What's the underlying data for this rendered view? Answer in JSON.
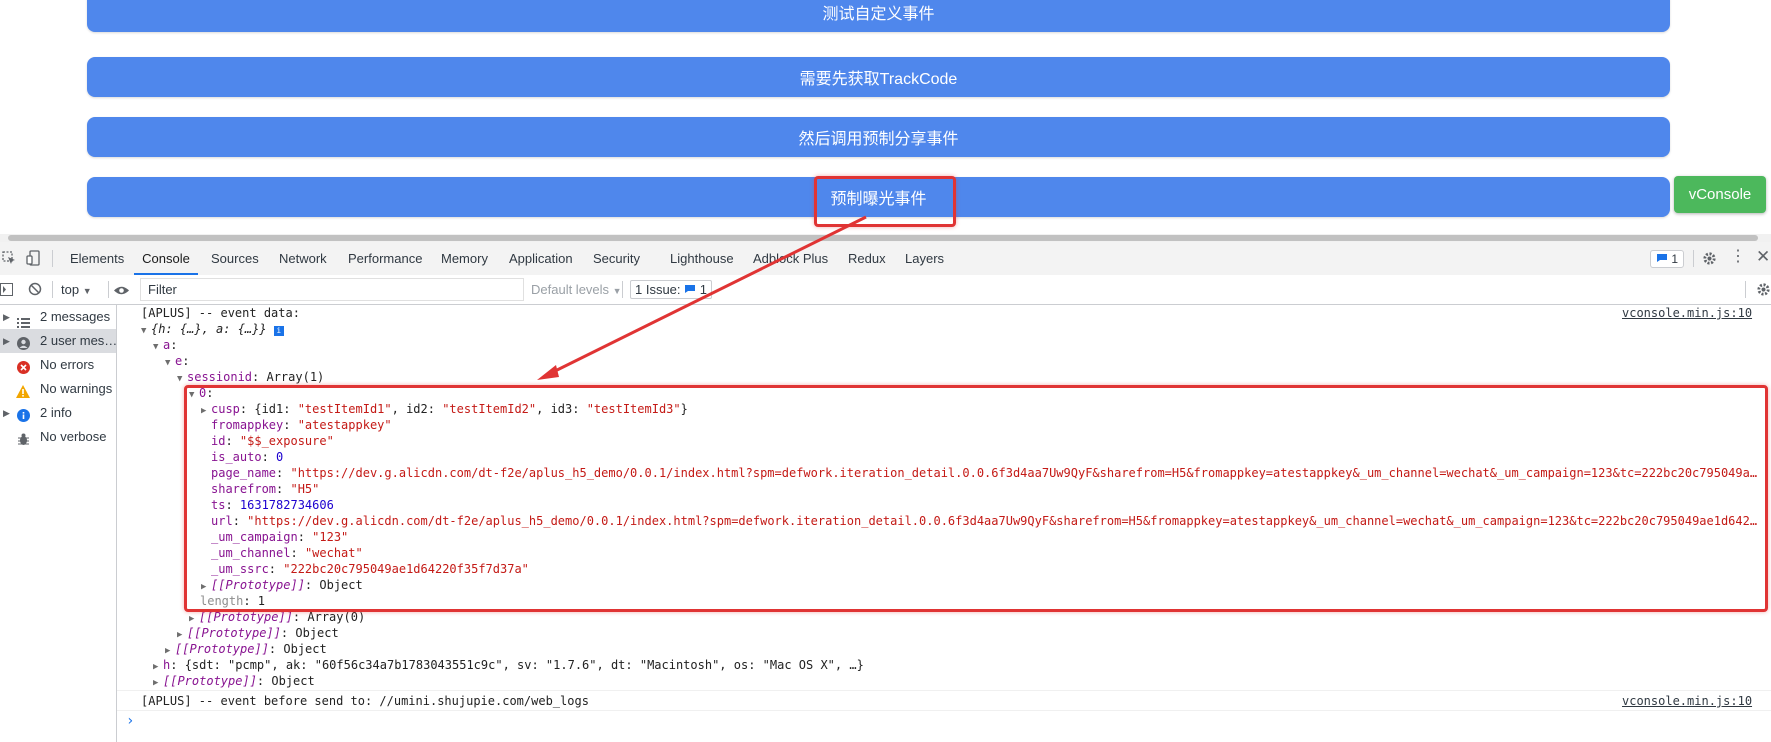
{
  "page": {
    "buttons": [
      "测试自定义事件",
      "需要先获取TrackCode",
      "然后调用预制分享事件",
      "预制曝光事件"
    ],
    "vconsole_label": "vConsole"
  },
  "devtools": {
    "tabs": [
      "Elements",
      "Console",
      "Sources",
      "Network",
      "Performance",
      "Memory",
      "Application",
      "Security",
      "Lighthouse",
      "Adblock Plus",
      "Redux",
      "Layers"
    ],
    "active_tab": "Console",
    "issues_badge": "1",
    "toolbar": {
      "context": "top",
      "filter_placeholder": "Filter",
      "levels": "Default levels",
      "issues_label": "1 Issue:",
      "issues_count": "1"
    },
    "sidebar": [
      {
        "label": "2 messages",
        "icon": "list-icon"
      },
      {
        "label": "2 user mes…",
        "icon": "user-icon"
      },
      {
        "label": "No errors",
        "icon": "error-icon"
      },
      {
        "label": "No warnings",
        "icon": "warning-icon"
      },
      {
        "label": "2 info",
        "icon": "info-icon"
      },
      {
        "label": "No verbose",
        "icon": "bug-icon"
      }
    ],
    "console": {
      "msg1_text": "[APLUS] -- event data:",
      "msg1_source": "vconsole.min.js:10",
      "obj_summary": "{h: {…}, a: {…}}",
      "a_key": "a",
      "e_key": "e",
      "sessionid_key": "sessionid",
      "sessionid_val": "Array(1)",
      "index0": "0",
      "cusp": {
        "key": "cusp",
        "id1": "\"testItemId1\"",
        "id2": "\"testItemId2\"",
        "id3": "\"testItemId3\""
      },
      "fromappkey": {
        "key": "fromappkey",
        "val": "\"atestappkey\""
      },
      "id": {
        "key": "id",
        "val": "\"$$_exposure\""
      },
      "is_auto": {
        "key": "is_auto",
        "val": "0"
      },
      "page_name": {
        "key": "page_name",
        "val": "\"https://dev.g.alicdn.com/dt-f2e/aplus_h5_demo/0.0.1/index.html?spm=defwork.iteration_detail.0.0.6f3d4aa7Uw9QyF&sharefrom=H5&fromappkey=atestappkey&_um_channel=wechat&_um_campaign=123&tc=222bc20c795049a…"
      },
      "sharefrom": {
        "key": "sharefrom",
        "val": "\"H5\""
      },
      "ts": {
        "key": "ts",
        "val": "1631782734606"
      },
      "url": {
        "key": "url",
        "val": "\"https://dev.g.alicdn.com/dt-f2e/aplus_h5_demo/0.0.1/index.html?spm=defwork.iteration_detail.0.0.6f3d4aa7Uw9QyF&sharefrom=H5&fromappkey=atestappkey&_um_channel=wechat&_um_campaign=123&tc=222bc20c795049ae1d642…"
      },
      "um_campaign": {
        "key": "_um_campaign",
        "val": "\"123\""
      },
      "um_channel": {
        "key": "_um_channel",
        "val": "\"wechat\""
      },
      "um_ssrc": {
        "key": "_um_ssrc",
        "val": "\"222bc20c795049ae1d64220f35f7d37a\""
      },
      "proto_object": "[[Prototype]]",
      "proto_object_val": ": Object",
      "length_key": "length",
      "length_val": ": 1",
      "proto_array_val": ": Array(0)",
      "h_line": {
        "key": "h",
        "summary": "{sdt: \"pcmp\", ak: \"60f56c34a7b1783043551c9c\", sv: \"1.7.6\", dt: \"Macintosh\", os: \"Mac OS X\", …}"
      },
      "msg2_text": "[APLUS] -- event before send to:  //umini.shujupie.com/web_logs",
      "msg2_source": "vconsole.min.js:10",
      "prompt": "›"
    }
  },
  "colors": {
    "button": "#4f87ec",
    "vconsole": "#4cb85c",
    "annotation": "#e03434"
  }
}
